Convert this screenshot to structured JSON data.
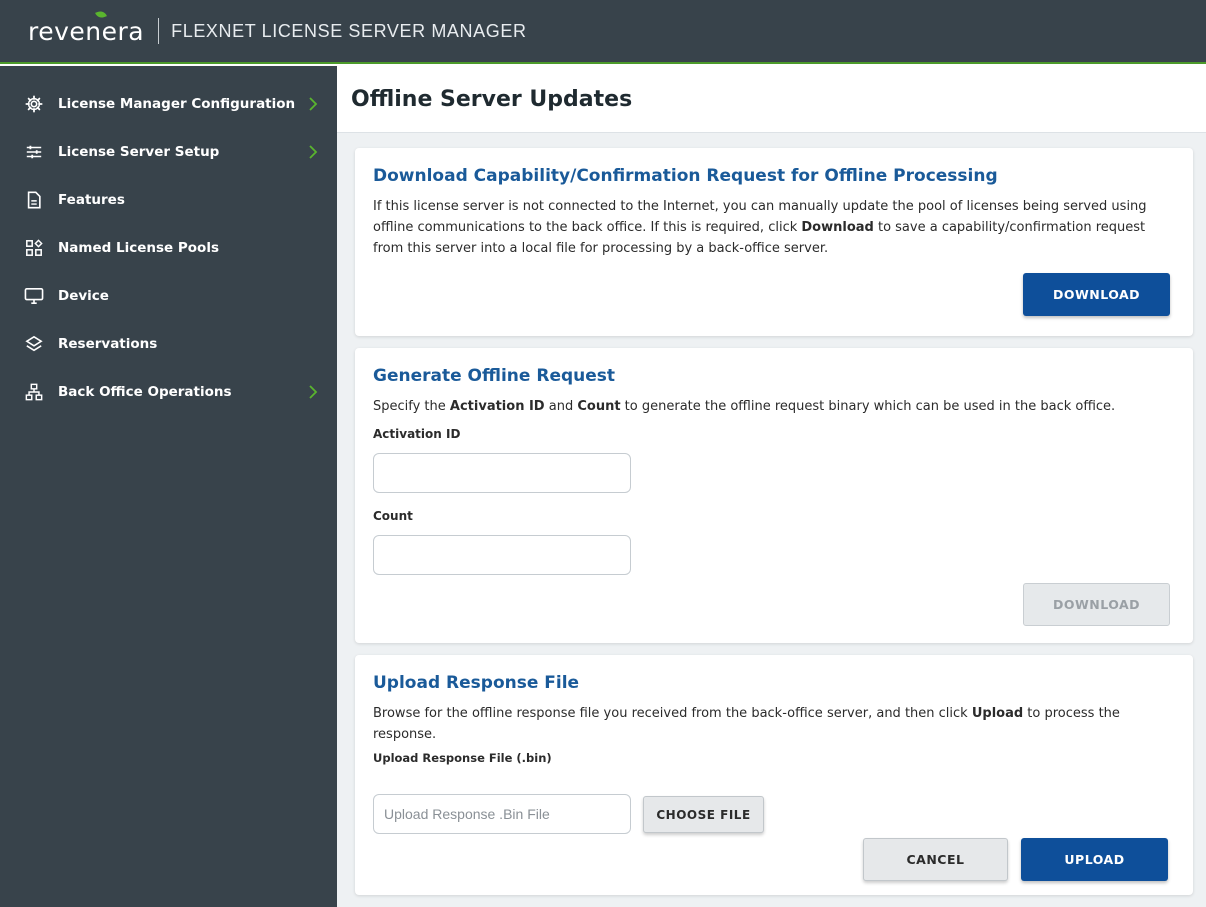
{
  "header": {
    "brand": "revenera",
    "product": "FLEXNET LICENSE SERVER MANAGER"
  },
  "sidebar": {
    "items": [
      {
        "label": "License Manager Configuration",
        "icon": "gear-icon",
        "has_submenu": true
      },
      {
        "label": "License Server Setup",
        "icon": "sliders-icon",
        "has_submenu": true
      },
      {
        "label": "Features",
        "icon": "document-icon",
        "has_submenu": false
      },
      {
        "label": "Named License Pools",
        "icon": "pool-grid-icon",
        "has_submenu": false
      },
      {
        "label": "Device",
        "icon": "monitor-icon",
        "has_submenu": false
      },
      {
        "label": "Reservations",
        "icon": "layers-icon",
        "has_submenu": false
      },
      {
        "label": "Back Office Operations",
        "icon": "sitemap-icon",
        "has_submenu": true
      }
    ]
  },
  "main": {
    "title": "Offline Server Updates",
    "download_section": {
      "title": "Download Capability/Confirmation Request for Offline Processing",
      "desc_part1": "If this license server is not connected to the Internet, you can manually update the pool of licenses being served using offline communications to the back office. If this is required, click ",
      "desc_bold": "Download",
      "desc_part2": " to save a capability/confirmation request from this server into a local file for processing by a back-office server.",
      "button": "DOWNLOAD"
    },
    "generate_section": {
      "title": "Generate Offline Request",
      "desc_part1": "Specify the ",
      "desc_bold1": "Activation ID",
      "desc_part2": " and ",
      "desc_bold2": "Count",
      "desc_part3": " to generate the offline request binary which can be used in the back office.",
      "activation_label": "Activation ID",
      "activation_value": "",
      "count_label": "Count",
      "count_value": "",
      "button": "DOWNLOAD"
    },
    "upload_section": {
      "title": "Upload Response File",
      "desc_part1": "Browse for the offline response file you received from the back-office server, and then click ",
      "desc_bold": "Upload",
      "desc_part2": " to process the response.",
      "file_label": "Upload Response File (.bin)",
      "file_placeholder": "Upload Response .Bin File",
      "choose_button": "CHOOSE FILE",
      "cancel_button": "CANCEL",
      "upload_button": "UPLOAD"
    }
  },
  "colors": {
    "topbar": "#38434b",
    "sidebar": "#38434b",
    "accent_green": "#5ab52e",
    "section_title": "#1a5a99",
    "primary_button": "#0e4f9a",
    "content_bg": "#eef1f3"
  }
}
